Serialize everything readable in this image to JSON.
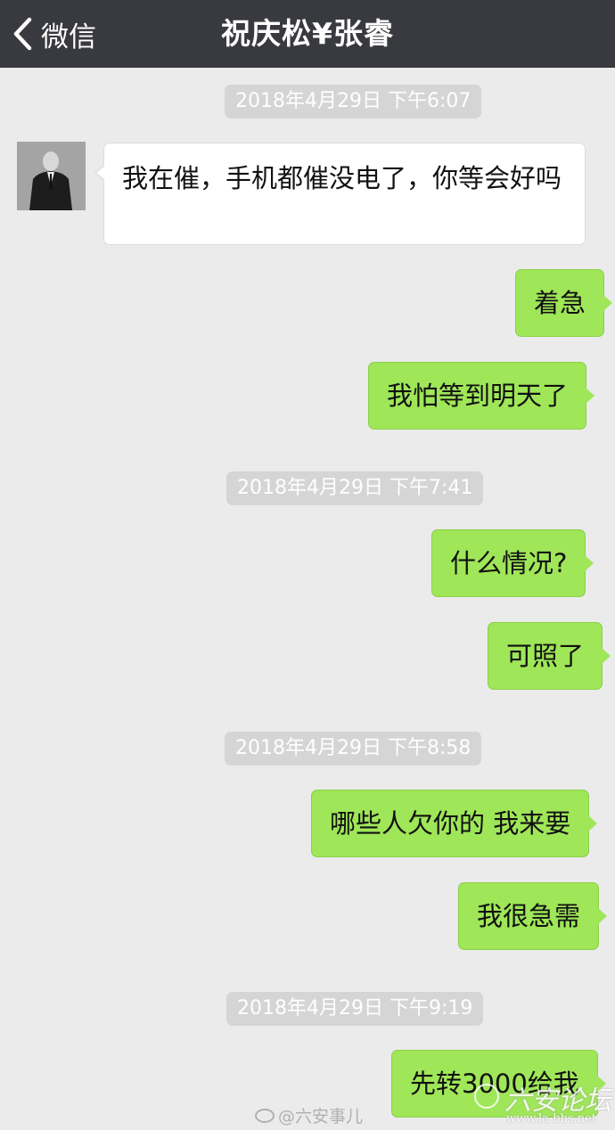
{
  "header": {
    "back_label": "微信",
    "title": "祝庆松¥张睿"
  },
  "timestamps": [
    "2018年4月29日 下午6:07",
    "2018年4月29日 下午7:41",
    "2018年4月29日 下午8:58",
    "2018年4月29日 下午9:19"
  ],
  "messages": [
    {
      "sender": "them",
      "text": "我在催，手机都催没电了，你等会好吗"
    },
    {
      "sender": "me",
      "text": "着急"
    },
    {
      "sender": "me",
      "text": "我怕等到明天了"
    },
    {
      "sender": "me",
      "text": "什么情况?"
    },
    {
      "sender": "me",
      "text": "可照了"
    },
    {
      "sender": "me",
      "text": "哪些人欠你的 我来要"
    },
    {
      "sender": "me",
      "text": "我很急需"
    },
    {
      "sender": "me",
      "text": "先转3000给我"
    }
  ],
  "watermarks": {
    "weibo": "@六安事儿",
    "site_name": "六安论坛",
    "site_url": "www.la-bbs.net"
  },
  "colors": {
    "header_bg": "#393a3f",
    "chat_bg": "#ebebeb",
    "outgoing_bubble": "#9fe658",
    "incoming_bubble": "#ffffff",
    "timestamp_bg": "#d5d5d5"
  }
}
